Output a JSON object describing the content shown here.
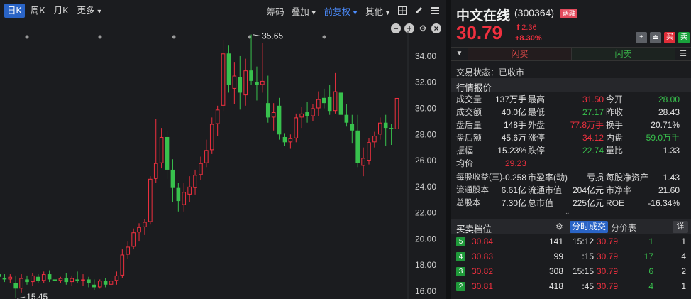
{
  "toolbar": {
    "periods": [
      "日K",
      "周K",
      "月K",
      "更多"
    ],
    "chip": "筹码",
    "overlay": "叠加",
    "adjust": "前复权",
    "other": "其他"
  },
  "chart_data": {
    "type": "candlestick",
    "ylim": [
      15.4,
      35.9
    ],
    "yticks": [
      "34.00",
      "32.00",
      "30.00",
      "28.00",
      "26.00",
      "24.00",
      "22.00",
      "20.00",
      "18.00",
      "16.00"
    ],
    "annotations": [
      {
        "label": "35.65",
        "value": 35.65,
        "kind": "high"
      },
      {
        "label": "15.45",
        "value": 15.45,
        "kind": "low"
      }
    ],
    "up_color": "#f0303f",
    "down_color": "#38c14d",
    "candles": [
      {
        "o": 17.3,
        "h": 17.6,
        "l": 16.9,
        "c": 17.1
      },
      {
        "o": 17.0,
        "h": 17.3,
        "l": 16.7,
        "c": 16.9
      },
      {
        "o": 16.9,
        "h": 17.3,
        "l": 16.6,
        "c": 17.1
      },
      {
        "o": 16.6,
        "h": 17.2,
        "l": 15.45,
        "c": 16.2
      },
      {
        "o": 16.2,
        "h": 17.3,
        "l": 15.9,
        "c": 17.0
      },
      {
        "o": 16.9,
        "h": 17.2,
        "l": 16.5,
        "c": 16.7
      },
      {
        "o": 16.7,
        "h": 17.4,
        "l": 16.4,
        "c": 17.2
      },
      {
        "o": 17.1,
        "h": 17.3,
        "l": 16.6,
        "c": 16.8
      },
      {
        "o": 16.8,
        "h": 17.5,
        "l": 16.6,
        "c": 17.3
      },
      {
        "o": 17.3,
        "h": 17.6,
        "l": 16.7,
        "c": 16.9
      },
      {
        "o": 16.9,
        "h": 17.2,
        "l": 16.5,
        "c": 16.8
      },
      {
        "o": 16.8,
        "h": 17.1,
        "l": 16.6,
        "c": 17.0
      },
      {
        "o": 17.0,
        "h": 17.4,
        "l": 16.5,
        "c": 16.7
      },
      {
        "o": 16.7,
        "h": 17.2,
        "l": 16.4,
        "c": 17.0
      },
      {
        "o": 16.9,
        "h": 17.5,
        "l": 16.6,
        "c": 16.8
      },
      {
        "o": 16.8,
        "h": 17.3,
        "l": 16.4,
        "c": 16.9
      },
      {
        "o": 16.9,
        "h": 17.1,
        "l": 16.3,
        "c": 16.6
      },
      {
        "o": 16.5,
        "h": 16.9,
        "l": 16.1,
        "c": 16.3
      },
      {
        "o": 16.3,
        "h": 16.9,
        "l": 16.2,
        "c": 16.8
      },
      {
        "o": 16.8,
        "h": 17.0,
        "l": 16.3,
        "c": 16.5
      },
      {
        "o": 16.5,
        "h": 17.0,
        "l": 16.3,
        "c": 16.8
      },
      {
        "o": 16.8,
        "h": 17.5,
        "l": 16.5,
        "c": 17.2
      },
      {
        "o": 17.2,
        "h": 19.2,
        "l": 17.0,
        "c": 18.8
      },
      {
        "o": 18.8,
        "h": 19.8,
        "l": 18.5,
        "c": 19.4
      },
      {
        "o": 19.4,
        "h": 20.8,
        "l": 19.2,
        "c": 20.5
      },
      {
        "o": 20.5,
        "h": 21.2,
        "l": 19.8,
        "c": 20.9
      },
      {
        "o": 20.9,
        "h": 21.5,
        "l": 20.3,
        "c": 21.3
      },
      {
        "o": 21.3,
        "h": 24.8,
        "l": 21.1,
        "c": 24.6
      },
      {
        "o": 24.6,
        "h": 29.2,
        "l": 24.3,
        "c": 25.8
      },
      {
        "o": 25.8,
        "h": 28.5,
        "l": 25.4,
        "c": 27.8
      },
      {
        "o": 27.8,
        "h": 28.3,
        "l": 24.6,
        "c": 25.3
      },
      {
        "o": 25.3,
        "h": 26.1,
        "l": 22.8,
        "c": 23.9
      },
      {
        "o": 23.9,
        "h": 24.3,
        "l": 22.1,
        "c": 22.9
      },
      {
        "o": 22.6,
        "h": 24.3,
        "l": 22.1,
        "c": 23.6
      },
      {
        "o": 23.4,
        "h": 24.8,
        "l": 22.8,
        "c": 24.0
      },
      {
        "o": 23.9,
        "h": 25.3,
        "l": 23.4,
        "c": 24.9
      },
      {
        "o": 24.9,
        "h": 26.3,
        "l": 24.5,
        "c": 25.8
      },
      {
        "o": 25.8,
        "h": 27.6,
        "l": 25.5,
        "c": 26.8
      },
      {
        "o": 26.8,
        "h": 29.3,
        "l": 26.5,
        "c": 28.8
      },
      {
        "o": 28.8,
        "h": 30.2,
        "l": 27.9,
        "c": 29.9
      },
      {
        "o": 30.2,
        "h": 35.2,
        "l": 29.8,
        "c": 34.2
      },
      {
        "o": 34.2,
        "h": 34.8,
        "l": 31.2,
        "c": 31.8
      },
      {
        "o": 31.5,
        "h": 33.5,
        "l": 30.3,
        "c": 32.5
      },
      {
        "o": 32.4,
        "h": 34.0,
        "l": 29.9,
        "c": 31.2
      },
      {
        "o": 31.0,
        "h": 33.8,
        "l": 30.2,
        "c": 32.9
      },
      {
        "o": 32.9,
        "h": 35.65,
        "l": 31.8,
        "c": 32.1
      },
      {
        "o": 32.0,
        "h": 33.2,
        "l": 30.6,
        "c": 31.8
      },
      {
        "o": 31.8,
        "h": 35.0,
        "l": 31.2,
        "c": 32.1
      },
      {
        "o": 30.4,
        "h": 32.5,
        "l": 28.9,
        "c": 29.3
      },
      {
        "o": 29.3,
        "h": 30.4,
        "l": 28.3,
        "c": 29.7
      },
      {
        "o": 30.2,
        "h": 30.8,
        "l": 27.6,
        "c": 28.0
      },
      {
        "o": 27.8,
        "h": 28.1,
        "l": 27.1,
        "c": 27.4
      },
      {
        "o": 27.4,
        "h": 28.0,
        "l": 26.9,
        "c": 27.7
      },
      {
        "o": 27.7,
        "h": 29.6,
        "l": 27.4,
        "c": 29.3
      },
      {
        "o": 29.3,
        "h": 30.1,
        "l": 28.5,
        "c": 29.6
      },
      {
        "o": 29.7,
        "h": 30.5,
        "l": 28.9,
        "c": 29.4
      },
      {
        "o": 29.4,
        "h": 30.3,
        "l": 29.0,
        "c": 30.0
      },
      {
        "o": 30.0,
        "h": 31.3,
        "l": 29.4,
        "c": 30.7
      },
      {
        "o": 30.8,
        "h": 31.5,
        "l": 30.0,
        "c": 30.4
      },
      {
        "o": 30.9,
        "h": 31.8,
        "l": 29.5,
        "c": 29.8
      },
      {
        "o": 29.8,
        "h": 32.7,
        "l": 29.6,
        "c": 31.3
      },
      {
        "o": 31.2,
        "h": 31.6,
        "l": 29.3,
        "c": 29.5
      },
      {
        "o": 29.5,
        "h": 30.3,
        "l": 28.6,
        "c": 28.9
      },
      {
        "o": 28.8,
        "h": 29.5,
        "l": 27.3,
        "c": 28.3
      },
      {
        "o": 28.3,
        "h": 29.5,
        "l": 25.5,
        "c": 25.8
      },
      {
        "o": 25.6,
        "h": 27.0,
        "l": 24.8,
        "c": 26.2
      },
      {
        "o": 26.0,
        "h": 27.7,
        "l": 25.7,
        "c": 27.4
      },
      {
        "o": 27.4,
        "h": 28.2,
        "l": 27.0,
        "c": 27.9
      },
      {
        "o": 28.0,
        "h": 29.3,
        "l": 27.6,
        "c": 28.9
      },
      {
        "o": 28.9,
        "h": 29.5,
        "l": 27.1,
        "c": 28.5
      },
      {
        "o": 28.5,
        "h": 28.8,
        "l": 27.2,
        "c": 28.4
      },
      {
        "o": 28.4,
        "h": 31.3,
        "l": 27.3,
        "c": 30.79
      }
    ]
  },
  "quote": {
    "name": "中文在线",
    "code": "(300364)",
    "badge": "两融",
    "price": "30.79",
    "change": "2.36",
    "change_arrow": "⬆",
    "change_pct": "+8.30%",
    "flash_buy": "闪买",
    "flash_sell": "闪卖",
    "status_label": "交易状态：",
    "status_value": "已收市",
    "section_title": "行情报价",
    "buttons": [
      "+",
      "⏏",
      "买",
      "卖"
    ]
  },
  "stats": [
    [
      {
        "l": "成交量",
        "v": "137万手",
        "c": "neutral"
      },
      {
        "l": "最高",
        "v": "31.50",
        "c": "up"
      },
      {
        "l": "今开",
        "v": "28.00",
        "c": "down"
      }
    ],
    [
      {
        "l": "成交额",
        "v": "40.0亿",
        "c": "neutral"
      },
      {
        "l": "最低",
        "v": "27.17",
        "c": "down"
      },
      {
        "l": "昨收",
        "v": "28.43",
        "c": "neutral"
      }
    ],
    [
      {
        "l": "盘后量",
        "v": "148手",
        "c": "neutral"
      },
      {
        "l": "外盘",
        "v": "77.8万手",
        "c": "up"
      },
      {
        "l": "换手",
        "v": "20.71%",
        "c": "neutral"
      }
    ],
    [
      {
        "l": "盘后额",
        "v": "45.6万",
        "c": "neutral"
      },
      {
        "l": "涨停",
        "v": "34.12",
        "c": "up"
      },
      {
        "l": "内盘",
        "v": "59.0万手",
        "c": "down"
      }
    ],
    [
      {
        "l": "振幅",
        "v": "15.23%",
        "c": "neutral"
      },
      {
        "l": "跌停",
        "v": "22.74",
        "c": "down"
      },
      {
        "l": "量比",
        "v": "1.33",
        "c": "neutral"
      }
    ],
    [
      {
        "l": "均价",
        "v": "29.23",
        "c": "up"
      }
    ],
    [
      {
        "l": "每股收益(三)",
        "v": "-0.258",
        "c": "neutral"
      },
      {
        "l": "市盈率(动)",
        "v": "亏损",
        "c": "neutral"
      },
      {
        "l": "每股净资产",
        "v": "1.43",
        "c": "neutral"
      }
    ],
    [
      {
        "l": "流通股本",
        "v": "6.61亿",
        "c": "neutral"
      },
      {
        "l": "流通市值",
        "v": "204亿元",
        "c": "neutral"
      },
      {
        "l": "市净率",
        "v": "21.60",
        "c": "neutral"
      }
    ],
    [
      {
        "l": "总股本",
        "v": "7.30亿",
        "c": "neutral"
      },
      {
        "l": "总市值",
        "v": "225亿元",
        "c": "neutral"
      },
      {
        "l": "ROE",
        "v": "-16.34%",
        "c": "neutral"
      }
    ]
  ],
  "depth": {
    "title": "买卖档位",
    "tick_tab": "分时成交",
    "price_tab": "分价表",
    "detail": "详",
    "sells": [
      {
        "level": "5",
        "price": "30.84",
        "vol": "141"
      },
      {
        "level": "4",
        "price": "30.83",
        "vol": "99"
      },
      {
        "level": "3",
        "price": "30.82",
        "vol": "308"
      },
      {
        "level": "2",
        "price": "30.81",
        "vol": "418"
      }
    ],
    "ticks": [
      {
        "time": "15:12",
        "price": "30.79",
        "vol": "1",
        "num": "1"
      },
      {
        "time": ":15",
        "price": "30.79",
        "vol": "17",
        "num": "4"
      },
      {
        "time": "15:15",
        "price": "30.79",
        "vol": "6",
        "num": "2"
      },
      {
        "time": ":45",
        "price": "30.79",
        "vol": "4",
        "num": "1"
      }
    ]
  }
}
